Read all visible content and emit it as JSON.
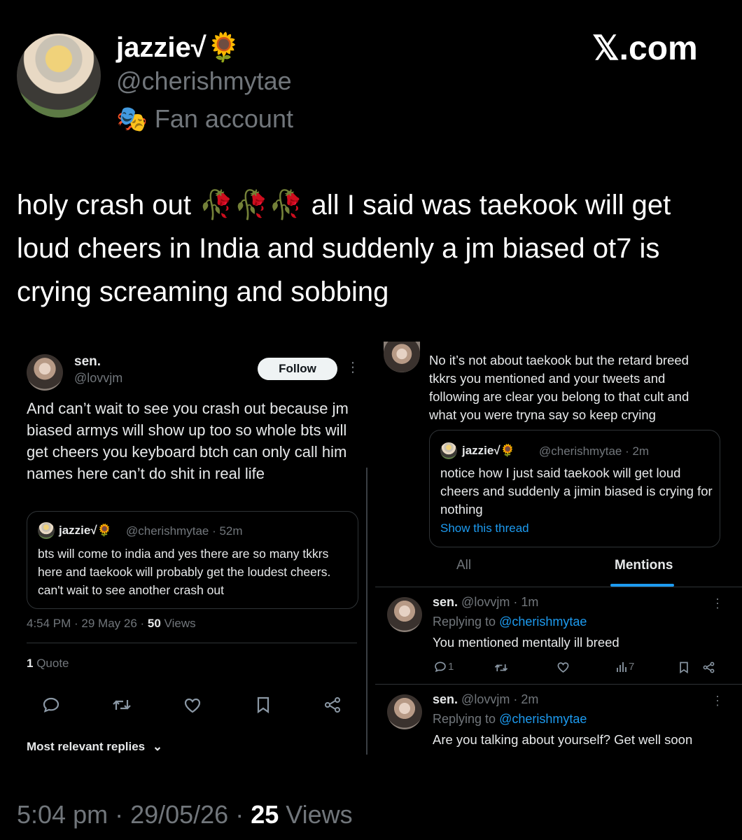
{
  "main_tweet": {
    "display_name": "jazzie",
    "name_suffix": "√🌻",
    "handle": "@cherishmytae",
    "label_emoji": "🎭",
    "label": "Fan account",
    "brand": "𝕏.com",
    "text": "holy crash out 🥀🥀🥀 all I said was taekook will get loud cheers in India and suddenly a jm biased ot7 is crying screaming and sobbing",
    "footer": {
      "time": "5:04 pm · 29/05/26 · ",
      "views_count": "25",
      "views_label": " Views"
    }
  },
  "left_shot": {
    "name": "sen.",
    "handle": "@lovvjm",
    "follow_label": "Follow",
    "more": "⋮",
    "text": "And can’t wait to see you crash out because jm biased armys will show up too so whole bts will get cheers you keyboard btch can only call him names here can’t do shit in real life",
    "quote": {
      "name": "jazzie√🌻",
      "meta": "@cherishmytae · 52m",
      "text": "bts will come to india and yes there are so many tkkrs here and taekook will probably get the loudest cheers. can't wait to see another crash out"
    },
    "meta": {
      "time": "4:54 PM · 29 May 26 · ",
      "views_count": "50",
      "views_label": " Views"
    },
    "quotes": {
      "count": "1",
      "label": " Quote"
    },
    "replies_sort": "Most relevant replies",
    "chevron": "⌄"
  },
  "right_shot": {
    "text": "No it’s not about taekook but the retard breed tkkrs you mentioned and your tweets and following are clear you belong to that cult and what you were tryna say so keep crying",
    "quote": {
      "name": "jazzie√🌻",
      "meta": "@cherishmytae · 2m",
      "text": "notice how I just said taekook will get loud cheers and suddenly a jimin biased is crying for nothing",
      "link": "Show this thread"
    },
    "tabs": [
      {
        "label": "All"
      },
      {
        "label": "Mentions"
      }
    ],
    "replies": [
      {
        "name": "sen.",
        "meta": "@lovvjm · 1m",
        "replying_prefix": "Replying to ",
        "replying_handle": "@cherishmytae",
        "text": "You mentioned mentally ill breed",
        "reply_count": "1",
        "view_count": "7"
      },
      {
        "name": "sen.",
        "meta": "@lovvjm · 2m",
        "replying_prefix": "Replying to ",
        "replying_handle": "@cherishmytae",
        "text": "Are you talking about yourself? Get well soon"
      }
    ]
  },
  "colors": {
    "background": "#000000",
    "text": "#e7e9ea",
    "muted": "#71767b",
    "accent": "#1d9bf0",
    "divider": "#2f3336"
  },
  "icons": [
    "verified-check-icon",
    "sunflower-icon",
    "theater-mask-icon",
    "reply-icon",
    "retweet-icon",
    "like-icon",
    "bookmark-icon",
    "share-icon",
    "views-icon",
    "more-icon"
  ]
}
